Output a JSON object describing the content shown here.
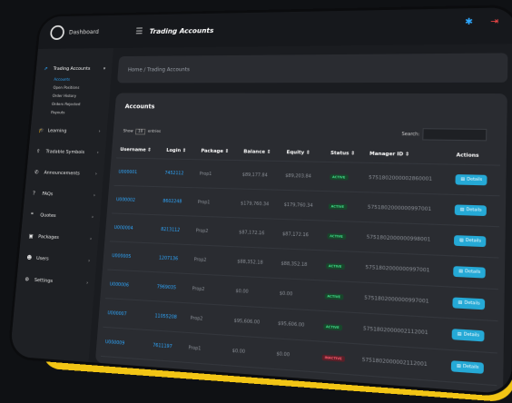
{
  "app": {
    "logo_text": "Dashboard",
    "page_heading": "Trading Accounts"
  },
  "breadcrumb": "Home / Trading Accounts",
  "sidebar": {
    "items": [
      {
        "label": "Trading Accounts",
        "icon": "chart-icon",
        "active": true
      },
      {
        "label": "Learning",
        "icon": "graduation-icon"
      },
      {
        "label": "Tradable Symbols",
        "icon": "upload-icon"
      },
      {
        "label": "Announcements",
        "icon": "megaphone-icon"
      },
      {
        "label": "FAQs",
        "icon": "question-icon"
      },
      {
        "label": "Quotes",
        "icon": "quote-icon"
      },
      {
        "label": "Packages",
        "icon": "box-icon"
      },
      {
        "label": "Users",
        "icon": "users-icon"
      },
      {
        "label": "Settings",
        "icon": "gear-icon"
      }
    ],
    "sub_items": [
      "Accounts",
      "Open Positions",
      "Order History",
      "Orders Rejected",
      "Payouts"
    ]
  },
  "card": {
    "title": "Accounts",
    "show_label": "Show",
    "show_value": "10",
    "entries_label": "entries",
    "search_label": "Search:"
  },
  "table": {
    "headers": [
      "Username",
      "Login",
      "Package",
      "Balance",
      "Equity",
      "Status",
      "Manager ID",
      "Actions"
    ],
    "rows": [
      [
        "U000001",
        "7452112",
        "Prop1",
        "$89,177.84",
        "$89,203.84",
        "ACTIVE",
        "5751802000002860001"
      ],
      [
        "U000002",
        "8602248",
        "Prop1",
        "$179,760.34",
        "$179,760.34",
        "ACTIVE",
        "5751802000000997001"
      ],
      [
        "U000004",
        "8213112",
        "Prop2",
        "$87,172.16",
        "$87,172.16",
        "ACTIVE",
        "5751802000000998001"
      ],
      [
        "U000005",
        "1207136",
        "Prop2",
        "$88,352.18",
        "$88,352.18",
        "ACTIVE",
        "5751802000000997001"
      ],
      [
        "U000006",
        "7969035",
        "Prop2",
        "$0.00",
        "$0.00",
        "ACTIVE",
        "5751802000000997001"
      ],
      [
        "U000007",
        "11055208",
        "Prop2",
        "$95,606.00",
        "$95,606.00",
        "ACTIVE",
        "5751802000002112001"
      ],
      [
        "U000009",
        "7611197",
        "Prop1",
        "$0.00",
        "$0.00",
        "INACTIVE",
        "5751802000002112001"
      ],
      [
        "U000012",
        "11003148",
        "Prop1",
        "$44,978.51",
        "$44,960.67",
        "ACTIVE",
        "5751802000009410158"
      ]
    ],
    "action_label": "Details"
  },
  "colors": {
    "accent": "#2ea8ff",
    "frame": "#f2c515",
    "active": "#3fe08a",
    "inactive": "#ff5a6e"
  }
}
